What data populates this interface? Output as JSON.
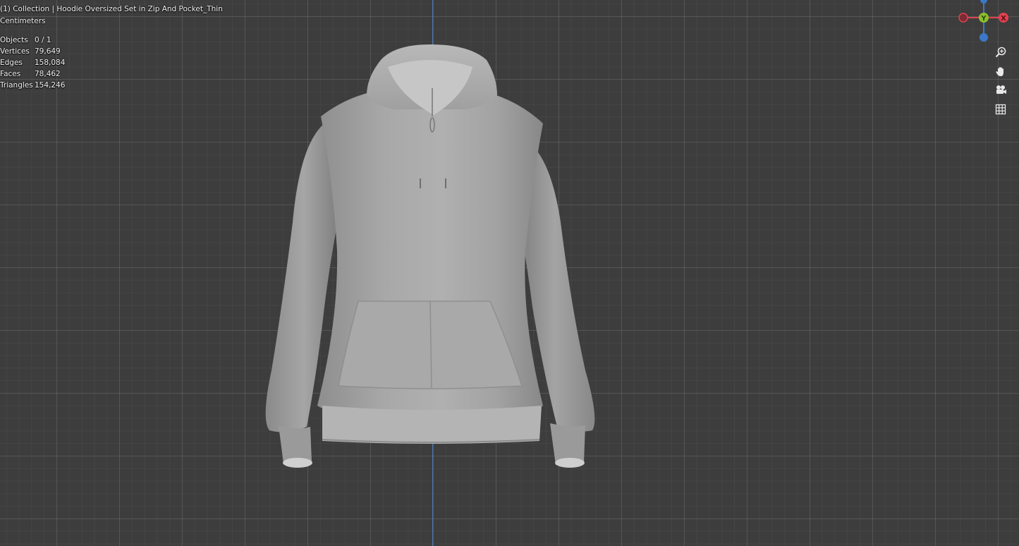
{
  "header": {
    "collection_line": "(1) Collection | Hoodie Oversized  Set in  Zip And Pocket_Thin",
    "units": "Centimeters"
  },
  "stats": [
    {
      "label": "Objects",
      "value": "0 / 1"
    },
    {
      "label": "Vertices",
      "value": "79,649"
    },
    {
      "label": "Edges",
      "value": "158,084"
    },
    {
      "label": "Faces",
      "value": "78,462"
    },
    {
      "label": "Triangles",
      "value": "154,246"
    }
  ],
  "gizmo": {
    "y_label": "Y",
    "x_label": "X",
    "colors": {
      "x": "#e0414f",
      "y": "#8ac12d",
      "z": "#3c78c8"
    }
  },
  "navigation": {
    "buttons": [
      "zoom-icon",
      "hand-pan-icon",
      "camera-icon",
      "grid-icon"
    ]
  },
  "viewport": {
    "background": "#3d3d3d",
    "object": "hoodie-model"
  }
}
